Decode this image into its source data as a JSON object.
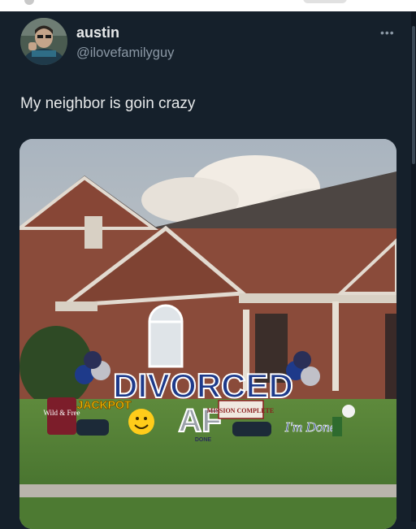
{
  "tweet": {
    "display_name": "austin",
    "handle": "@ilovefamilyguy",
    "more_label": "•••",
    "text": "My neighbor is goin crazy"
  },
  "media": {
    "sign_main": "DIVORCED",
    "sign_af": "AF",
    "sign_wild_free": "Wild & Free",
    "sign_jackpot": "JACKPOT",
    "sign_mission": "MISSION COMPLETE",
    "sign_done": "I'm Done",
    "sign_done_small": "DONE"
  },
  "icons": {
    "avatar": "user-avatar",
    "more": "more-options-icon"
  },
  "colors": {
    "background": "#15202b",
    "text_primary": "#e7e9ea",
    "text_secondary": "#8b98a5",
    "sign_blue": "#1e3a8a"
  }
}
